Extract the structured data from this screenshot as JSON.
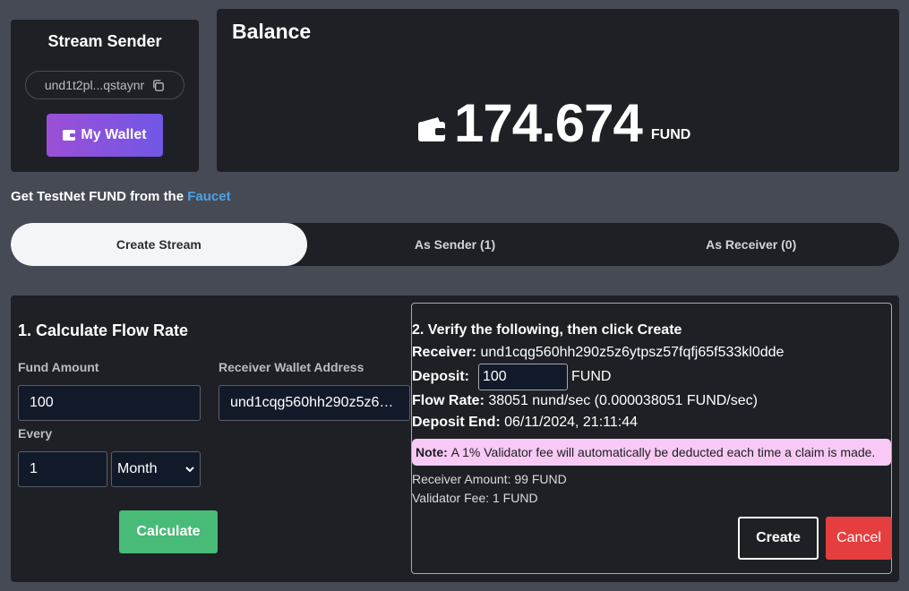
{
  "sender": {
    "title": "Stream Sender",
    "address": "und1t2pl...qstaynr",
    "wallet_button": "My Wallet"
  },
  "balance": {
    "title": "Balance",
    "amount": "174.674",
    "unit": "FUND"
  },
  "faucet": {
    "prefix": "Get TestNet FUND from the ",
    "link": "Faucet"
  },
  "tabs": [
    {
      "label": "Create Stream",
      "active": true
    },
    {
      "label": "As Sender (1)",
      "active": false
    },
    {
      "label": "As Receiver (0)",
      "active": false
    }
  ],
  "calculate": {
    "title": "1. Calculate Flow Rate",
    "fund_amount_label": "Fund Amount",
    "fund_amount_value": "100",
    "receiver_label": "Receiver Wallet Address",
    "receiver_value": "und1cqg560hh290z5z6…",
    "every_label": "Every",
    "every_value": "1",
    "period_value": "Month",
    "button": "Calculate"
  },
  "verify": {
    "title": "2. Verify the following, then click Create",
    "receiver_label": "Receiver:",
    "receiver_value": "und1cqg560hh290z5z6ytpsz57fqfj65f533kl0dde",
    "deposit_label": "Deposit:",
    "deposit_value": "100",
    "deposit_unit": "FUND",
    "flow_rate_label": "Flow Rate:",
    "flow_rate_value": "38051 nund/sec (0.000038051 FUND/sec)",
    "deposit_end_label": "Deposit End:",
    "deposit_end_value": "06/11/2024, 21:11:44",
    "note_label": "Note:",
    "note_text": "A 1% Validator fee will automatically be deducted each time a claim is made.",
    "receiver_amount": "Receiver Amount: 99 FUND",
    "validator_fee": "Validator Fee: 1 FUND",
    "create_button": "Create",
    "cancel_button": "Cancel"
  }
}
